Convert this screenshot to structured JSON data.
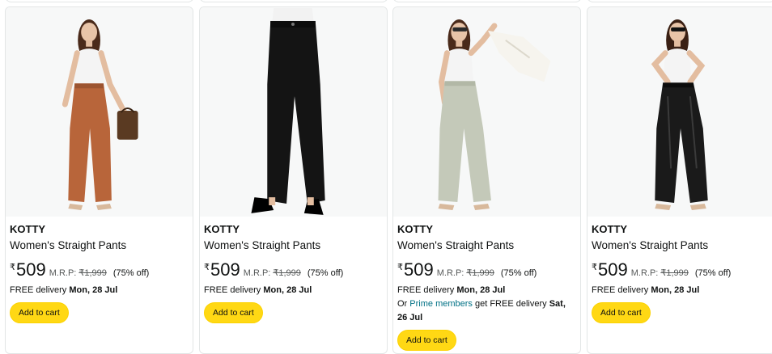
{
  "products": [
    {
      "brand": "KOTTY",
      "title": "Women's Straight Pants",
      "currency": "₹",
      "price": "509",
      "mrp_label": "M.R.P:",
      "mrp": "₹1,999",
      "discount": "(75% off)",
      "delivery_prefix": "FREE delivery",
      "delivery_date": "Mon, 28 Jul",
      "button": "Add to cart",
      "pants_color": "#b8653a",
      "accessory": "brown handbag"
    },
    {
      "brand": "KOTTY",
      "title": "Women's Straight Pants",
      "currency": "₹",
      "price": "509",
      "mrp_label": "M.R.P:",
      "mrp": "₹1,999",
      "discount": "(75% off)",
      "delivery_prefix": "FREE delivery",
      "delivery_date": "Mon, 28 Jul",
      "button": "Add to cart",
      "pants_color": "#141414"
    },
    {
      "brand": "KOTTY",
      "title": "Women's Straight Pants",
      "currency": "₹",
      "price": "509",
      "mrp_label": "M.R.P:",
      "mrp": "₹1,999",
      "discount": "(75% off)",
      "delivery_prefix": "FREE delivery",
      "delivery_date": "Mon, 28 Jul",
      "prime": {
        "prefix": "Or",
        "link": "Prime members",
        "middle": "get FREE delivery",
        "date": "Sat, 26 Jul"
      },
      "button": "Add to cart",
      "pants_color": "#c4c9b9",
      "accessory": "white blazer"
    },
    {
      "brand": "KOTTY",
      "title": "Women's Straight Pants",
      "currency": "₹",
      "price": "509",
      "mrp_label": "M.R.P:",
      "mrp": "₹1,999",
      "discount": "(75% off)",
      "delivery_prefix": "FREE delivery",
      "delivery_date": "Mon, 28 Jul",
      "button": "Add to cart",
      "pants_color": "#1a1a1a"
    }
  ]
}
